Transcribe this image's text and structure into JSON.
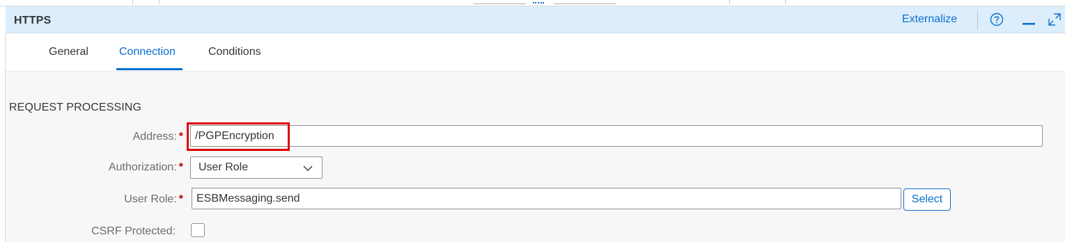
{
  "header": {
    "title": "HTTPS",
    "externalize_label": "Externalize",
    "icons": [
      "help-icon",
      "minimize-icon",
      "maximize-icon"
    ]
  },
  "tabs": [
    {
      "label": "General",
      "active": false
    },
    {
      "label": "Connection",
      "active": true
    },
    {
      "label": "Conditions",
      "active": false
    }
  ],
  "section": {
    "title": "REQUEST PROCESSING"
  },
  "fields": {
    "address": {
      "label": "Address:",
      "required": "*",
      "value": "/PGPEncryption"
    },
    "authorization": {
      "label": "Authorization:",
      "required": "*",
      "value": "User Role"
    },
    "user_role": {
      "label": "User Role:",
      "required": "*",
      "value": "ESBMessaging.send",
      "button_label": "Select"
    },
    "csrf": {
      "label": "CSRF Protected:",
      "checked": false
    }
  },
  "colors": {
    "accent": "#0a6ed1",
    "header_bg": "#dcedfb",
    "required": "#bb0000",
    "highlight": "#e00000",
    "content_bg": "#f7f7f7"
  }
}
